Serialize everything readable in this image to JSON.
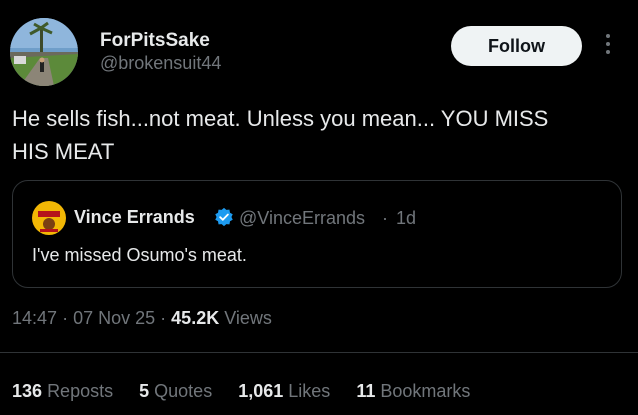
{
  "author": {
    "name": "ForPitsSake",
    "handle": "@brokensuit44"
  },
  "follow_label": "Follow",
  "tweet_text": "He sells fish...not meat. Unless you mean... YOU MISS\nHIS MEAT",
  "quote": {
    "name": "Vince Errands",
    "handle": "@VinceErrands",
    "separator": "·",
    "time": "1d",
    "text": "I've missed Osumo's meat."
  },
  "meta": {
    "time": "14:47",
    "date": "07 Nov 25",
    "separator": "·",
    "views_count": "45.2K",
    "views_label": "Views"
  },
  "stats": [
    {
      "count": "136",
      "label": "Reposts"
    },
    {
      "count": "5",
      "label": "Quotes"
    },
    {
      "count": "1,061",
      "label": "Likes"
    },
    {
      "count": "11",
      "label": "Bookmarks"
    }
  ],
  "colors": {
    "background": "#000000",
    "text_primary": "#e7e9ea",
    "text_secondary": "#71767b",
    "border": "#2f3336",
    "verified": "#1d9bf0",
    "button_bg": "#eff3f4"
  },
  "icons": [
    "more-icon",
    "verified-badge-icon"
  ]
}
